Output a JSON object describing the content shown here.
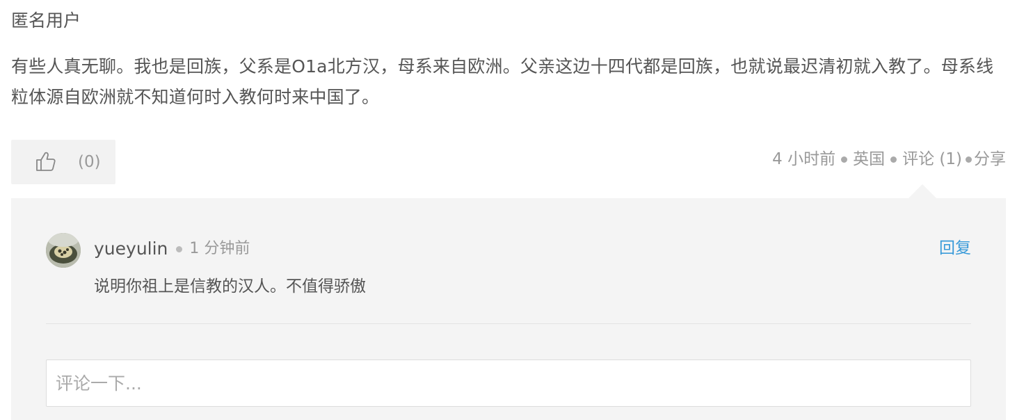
{
  "post": {
    "author": "匿名用户",
    "content": "有些人真无聊。我也是回族，父系是O1a北方汉，母系来自欧洲。父亲这边十四代都是回族，也就说最迟清初就入教了。母系线粒体源自欧洲就不知道何时入教何时来中国了。"
  },
  "actions": {
    "like_count": "(0)",
    "time": "4 小时前",
    "location": "英国",
    "comments": "评论 (1)",
    "share": "分享"
  },
  "comments": [
    {
      "user": "yueyulin",
      "time": "1 分钟前",
      "reply_label": "回复",
      "text": "说明你祖上是信教的汉人。不值得骄傲"
    }
  ],
  "comment_input": {
    "placeholder": "评论一下..."
  },
  "icons": {
    "like": "thumbs-up-icon"
  },
  "colors": {
    "link": "#3a9bd9",
    "panel_bg": "#f4f4f4",
    "muted_text": "#999999"
  }
}
